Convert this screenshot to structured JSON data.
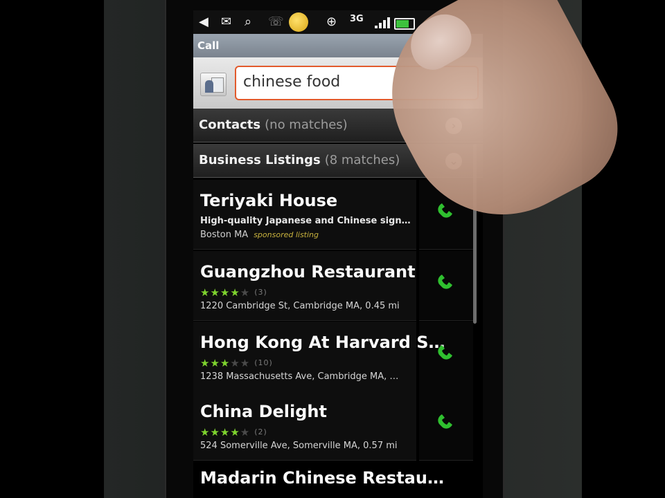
{
  "status_bar": {
    "network": "3G",
    "icons": [
      "back-arrow-icon",
      "mail-icon",
      "search-icon",
      "missed-call-icon",
      "weather-sun-icon",
      "gps-icon",
      "signal-icon",
      "battery-icon"
    ]
  },
  "titlebar": {
    "title": "Call"
  },
  "search": {
    "value": "chinese food"
  },
  "sections": {
    "contacts": {
      "label": "Contacts",
      "count": "(no matches)"
    },
    "business": {
      "label": "Business Listings",
      "count": "(8 matches)"
    }
  },
  "listings": [
    {
      "name": "Teriyaki House",
      "description": "High-quality Japanese and Chinese sign…",
      "location": "Boston MA",
      "badge": "sponsored listing"
    },
    {
      "name": "Guangzhou Restaurant",
      "rating": 4,
      "reviews": "(3)",
      "address": "1220 Cambridge St, Cambridge MA, 0.45 mi"
    },
    {
      "name": "Hong Kong At Harvard S…",
      "rating": 3,
      "reviews": "(10)",
      "address": "1238 Massachusetts Ave, Cambridge MA, …"
    },
    {
      "name": "China Delight",
      "rating": 4,
      "reviews": "(2)",
      "address": "524 Somerville Ave, Somerville MA, 0.57 mi"
    },
    {
      "name": "Madarin Chinese Restau…"
    }
  ],
  "colors": {
    "accent_orange": "#e25a2c",
    "call_green": "#2fbf2f",
    "star_green": "#7ed32e"
  }
}
